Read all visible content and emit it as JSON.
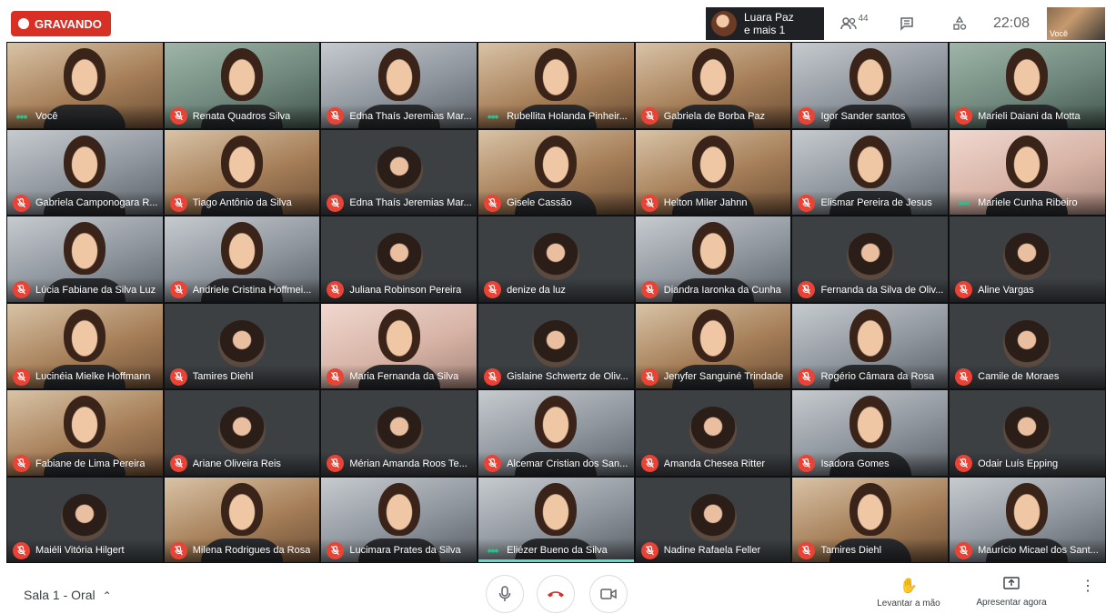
{
  "recording": {
    "label": "GRAVANDO",
    "color": "#d93025"
  },
  "active_speaker": {
    "name": "Luara Paz",
    "extra": "e mais 1"
  },
  "top_controls": {
    "participants_count": "44",
    "time": "22:08",
    "self_label": "Você"
  },
  "tiles": [
    {
      "name": "Você",
      "state": "speaking",
      "view": "cam warm"
    },
    {
      "name": "Renata Quadros Silva",
      "state": "muted",
      "view": "cam green"
    },
    {
      "name": "Edna Thaís Jeremias Mar...",
      "state": "muted",
      "view": "cam cool"
    },
    {
      "name": "Rubellita Holanda Pinheir...",
      "state": "speaking",
      "view": "cam warm"
    },
    {
      "name": "Gabriela de Borba Paz",
      "state": "muted",
      "view": "cam warm"
    },
    {
      "name": "Igor Sander santos",
      "state": "muted",
      "view": "cam cool"
    },
    {
      "name": "Marieli Daiani da Motta",
      "state": "muted",
      "view": "cam green"
    },
    {
      "name": "Gabriela Camponogara R...",
      "state": "muted",
      "view": "cam cool"
    },
    {
      "name": "Tiago Antônio da Silva",
      "state": "muted",
      "view": "cam warm"
    },
    {
      "name": "Edna Thaís Jeremias Mar...",
      "state": "muted",
      "view": "avatar"
    },
    {
      "name": "Gisele Cassão",
      "state": "muted",
      "view": "cam warm"
    },
    {
      "name": "Helton Miler Jahnn",
      "state": "muted",
      "view": "cam warm"
    },
    {
      "name": "Elismar Pereira de Jesus",
      "state": "muted",
      "view": "cam cool"
    },
    {
      "name": "Mariele Cunha Ribeiro",
      "state": "speaking",
      "view": "cam pink"
    },
    {
      "name": "Lúcia Fabiane da Silva Luz",
      "state": "muted",
      "view": "cam cool"
    },
    {
      "name": "Andriele Cristina Hoffmei...",
      "state": "muted",
      "view": "cam cool"
    },
    {
      "name": "Juliana Robinson Pereira",
      "state": "muted",
      "view": "avatar"
    },
    {
      "name": "denize da luz",
      "state": "muted",
      "view": "avatar"
    },
    {
      "name": "Diandra Iaronka da Cunha",
      "state": "muted",
      "view": "cam cool"
    },
    {
      "name": "Fernanda da Silva de Oliv...",
      "state": "muted",
      "view": "avatar"
    },
    {
      "name": "Aline Vargas",
      "state": "muted",
      "view": "avatar"
    },
    {
      "name": "Lucinéia Mielke Hoffmann",
      "state": "muted",
      "view": "cam warm"
    },
    {
      "name": "Tamires Diehl",
      "state": "muted",
      "view": "avatar"
    },
    {
      "name": "Maria Fernanda da Silva",
      "state": "muted",
      "view": "cam pink"
    },
    {
      "name": "Gislaine Schwertz de Oliv...",
      "state": "muted",
      "view": "avatar"
    },
    {
      "name": "Jenyfer Sanguiné Trindade",
      "state": "muted",
      "view": "cam warm"
    },
    {
      "name": "Rogério Câmara da Rosa",
      "state": "muted",
      "view": "cam cool"
    },
    {
      "name": "Camile de Moraes",
      "state": "muted",
      "view": "avatar"
    },
    {
      "name": "Fabiane de Lima Pereira",
      "state": "muted",
      "view": "cam warm"
    },
    {
      "name": "Ariane Oliveira Reis",
      "state": "muted",
      "view": "avatar"
    },
    {
      "name": "Mérian Amanda Roos Te...",
      "state": "muted",
      "view": "avatar"
    },
    {
      "name": "Alcemar Cristian dos San...",
      "state": "muted",
      "view": "cam cool"
    },
    {
      "name": "Amanda Chesea Ritter",
      "state": "muted",
      "view": "avatar"
    },
    {
      "name": "Isadora Gomes",
      "state": "muted",
      "view": "cam cool"
    },
    {
      "name": "Odair Luís Epping",
      "state": "muted",
      "view": "avatar"
    },
    {
      "name": "Maiéli Vitória Hilgert",
      "state": "muted",
      "view": "avatar"
    },
    {
      "name": "Milena Rodrigues da Rosa",
      "state": "muted",
      "view": "cam warm"
    },
    {
      "name": "Lucimara Prates da Silva",
      "state": "muted",
      "view": "cam cool"
    },
    {
      "name": "Eliézer Bueno da Silva",
      "state": "speaking-active",
      "view": "cam cool"
    },
    {
      "name": "Nadine Rafaela Feller",
      "state": "muted",
      "view": "avatar"
    },
    {
      "name": "Tamires Diehl",
      "state": "muted",
      "view": "cam warm"
    },
    {
      "name": "Maurício Micael dos Sant...",
      "state": "muted",
      "view": "cam cool"
    }
  ],
  "footer": {
    "room": "Sala 1 - Oral",
    "raise_hand": "Levantar a mão",
    "present_now": "Apresentar agora"
  },
  "icons": {
    "mic": "mic-icon",
    "end_call": "end-call-icon",
    "camera": "camera-icon",
    "people": "people-icon",
    "chat": "chat-icon",
    "activities": "activities-icon",
    "hand": "hand-icon",
    "present": "present-icon",
    "more": "more-vert-icon"
  }
}
